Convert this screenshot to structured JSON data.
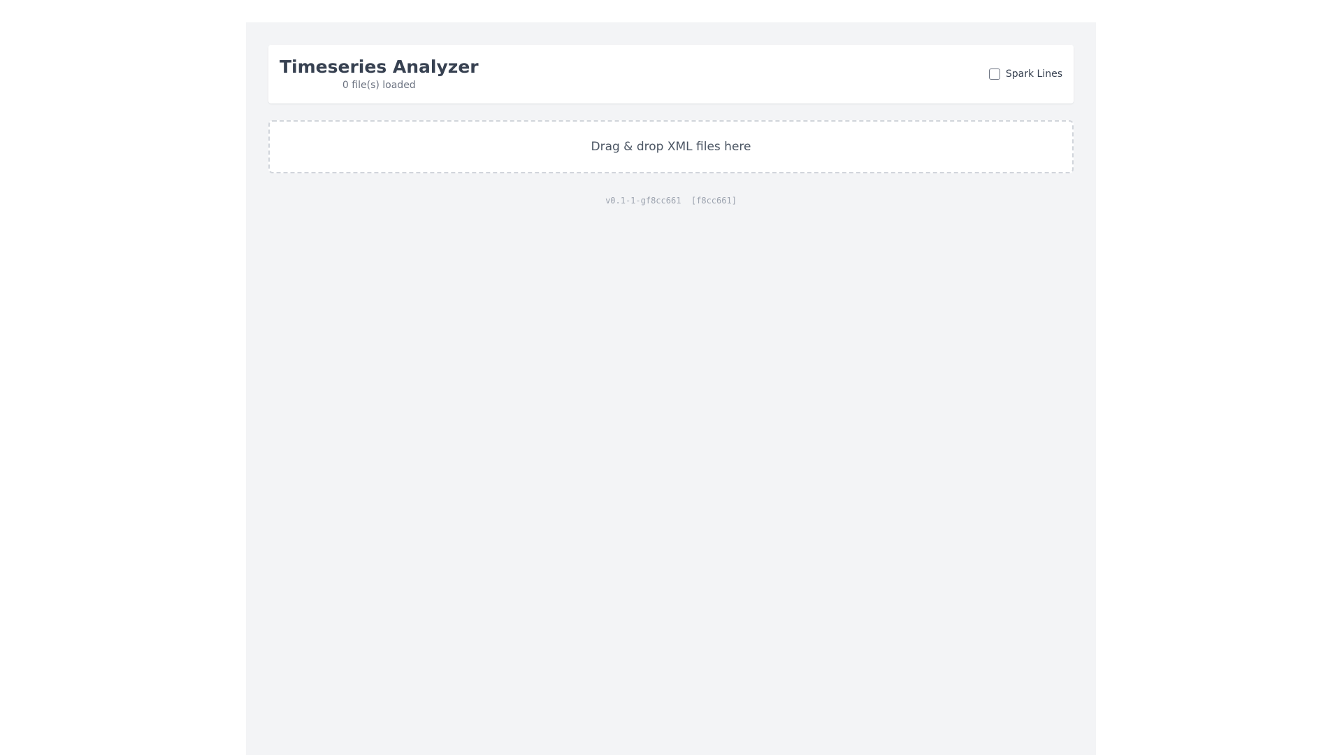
{
  "header": {
    "title": "Timeseries Analyzer",
    "file_count": "0 file(s) loaded"
  },
  "spark_lines": {
    "label": "Spark Lines",
    "checked": false
  },
  "drop_zone": {
    "text": "Drag & drop XML files here"
  },
  "footer": {
    "version": "v0.1-1-gf8cc661",
    "commit": "[f8cc661]"
  },
  "colors": {
    "background": "#f3f4f6",
    "card": "#ffffff",
    "title": "#374151",
    "muted": "#6b7280",
    "border_dashed": "#d1d5db"
  }
}
